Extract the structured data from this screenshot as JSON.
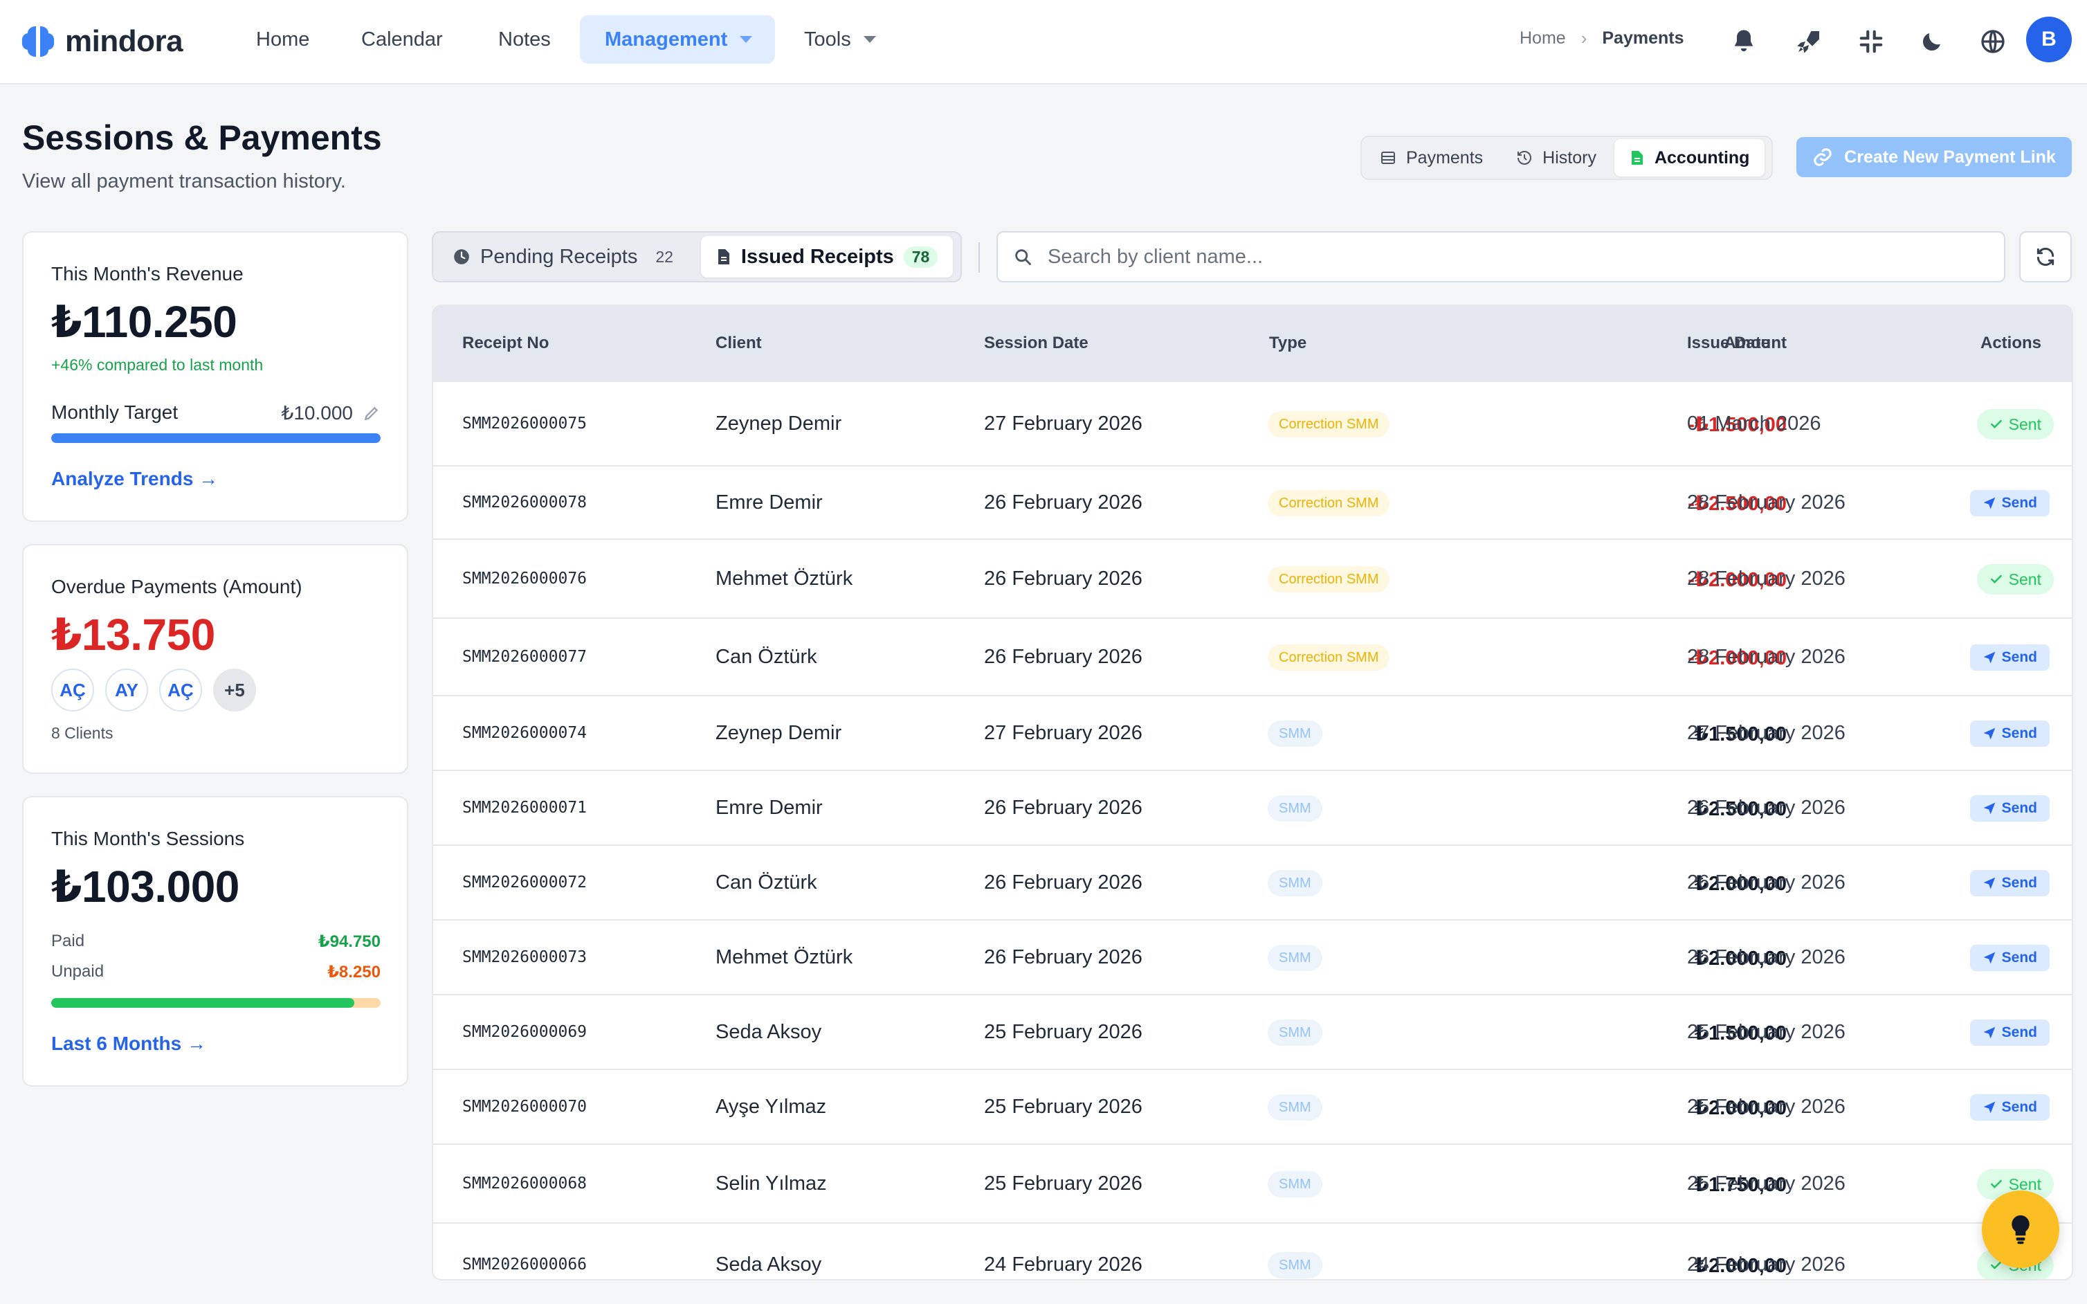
{
  "app": {
    "brand": "mindora",
    "accent": "#3b82f6"
  },
  "nav": {
    "items": [
      "Home",
      "Calendar",
      "Notes",
      "Management",
      "Tools"
    ],
    "active": "Management"
  },
  "breadcrumb": {
    "parent": "Home",
    "current": "Payments"
  },
  "user": {
    "initial": "B"
  },
  "header": {
    "title": "Sessions & Payments",
    "subtitle": "View all payment transaction history."
  },
  "view_switch": {
    "payments": "Payments",
    "history": "History",
    "accounting": "Accounting",
    "active": "Accounting"
  },
  "create_button": "Create New Payment Link",
  "revenue_card": {
    "label": "This Month's Revenue",
    "value": "₺110.250",
    "change": "+46% compared to last month",
    "target_label": "Monthly Target",
    "target_value": "₺10.000",
    "target_progress": 1.0,
    "link": "Analyze Trends →"
  },
  "overdue_card": {
    "label": "Overdue Payments (Amount)",
    "value": "₺13.750",
    "chips": [
      "AÇ",
      "AY",
      "AÇ"
    ],
    "more": "+5",
    "clients": "8 Clients"
  },
  "sessions_card": {
    "label": "This Month's Sessions",
    "value": "₺103.000",
    "paid_label": "Paid",
    "paid_value": "₺94.750",
    "unpaid_label": "Unpaid",
    "unpaid_value": "₺8.250",
    "paid_fraction": 0.92,
    "link": "Last 6 Months →"
  },
  "tabs": {
    "pending": {
      "label": "Pending Receipts",
      "count": "22"
    },
    "issued": {
      "label": "Issued Receipts",
      "count": "78"
    }
  },
  "search": {
    "placeholder": "Search by client name..."
  },
  "table": {
    "headers": [
      "Receipt No",
      "Client",
      "Session Date",
      "Type",
      "Amount",
      "Issue Date",
      "Actions"
    ],
    "rows": [
      {
        "no": "SMM2026000075",
        "client": "Zeynep Demir",
        "session": "27 February 2026",
        "type": "Correction SMM",
        "amount": "-₺1.500,00",
        "issue": "01 March 2026",
        "action": "Sent"
      },
      {
        "no": "SMM2026000078",
        "client": "Emre Demir",
        "session": "26 February 2026",
        "type": "Correction SMM",
        "amount": "-₺2.500,00",
        "issue": "28 February 2026",
        "action": "Send"
      },
      {
        "no": "SMM2026000076",
        "client": "Mehmet Öztürk",
        "session": "26 February 2026",
        "type": "Correction SMM",
        "amount": "-₺2.000,00",
        "issue": "28 February 2026",
        "action": "Sent"
      },
      {
        "no": "SMM2026000077",
        "client": "Can Öztürk",
        "session": "26 February 2026",
        "type": "Correction SMM",
        "amount": "-₺2.000,00",
        "issue": "28 February 2026",
        "action": "Send"
      },
      {
        "no": "SMM2026000074",
        "client": "Zeynep Demir",
        "session": "27 February 2026",
        "type": "SMM",
        "amount": "₺1.500,00",
        "issue": "27 February 2026",
        "action": "Send"
      },
      {
        "no": "SMM2026000071",
        "client": "Emre Demir",
        "session": "26 February 2026",
        "type": "SMM",
        "amount": "₺2.500,00",
        "issue": "26 February 2026",
        "action": "Send"
      },
      {
        "no": "SMM2026000072",
        "client": "Can Öztürk",
        "session": "26 February 2026",
        "type": "SMM",
        "amount": "₺2.000,00",
        "issue": "26 February 2026",
        "action": "Send"
      },
      {
        "no": "SMM2026000073",
        "client": "Mehmet Öztürk",
        "session": "26 February 2026",
        "type": "SMM",
        "amount": "₺2.000,00",
        "issue": "26 February 2026",
        "action": "Send"
      },
      {
        "no": "SMM2026000069",
        "client": "Seda Aksoy",
        "session": "25 February 2026",
        "type": "SMM",
        "amount": "₺1.500,00",
        "issue": "25 February 2026",
        "action": "Send"
      },
      {
        "no": "SMM2026000070",
        "client": "Ayşe Yılmaz",
        "session": "25 February 2026",
        "type": "SMM",
        "amount": "₺2.000,00",
        "issue": "25 February 2026",
        "action": "Send"
      },
      {
        "no": "SMM2026000068",
        "client": "Selin Yılmaz",
        "session": "25 February 2026",
        "type": "SMM",
        "amount": "₺1.750,00",
        "issue": "25 February 2026",
        "action": "Sent"
      },
      {
        "no": "SMM2026000066",
        "client": "Seda Aksoy",
        "session": "24 February 2026",
        "type": "SMM",
        "amount": "₺2.000,00",
        "issue": "24 February 2026",
        "action": "Sent"
      }
    ]
  }
}
